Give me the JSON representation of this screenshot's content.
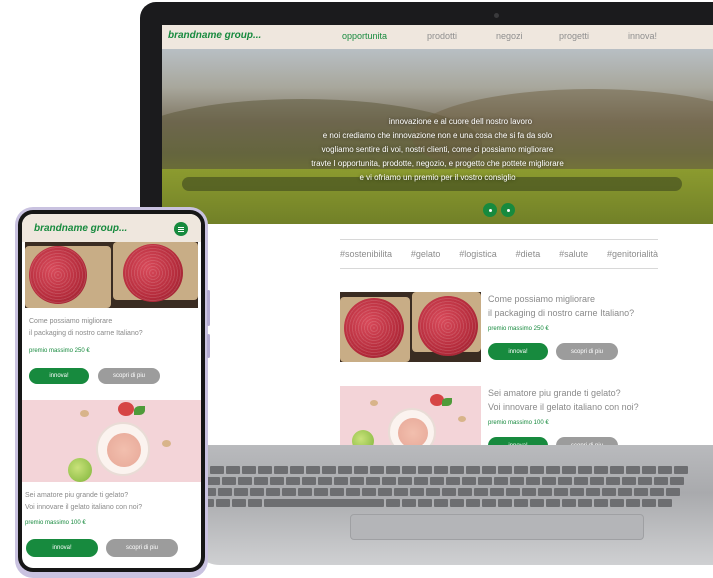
{
  "brand": "brandname group...",
  "desktop": {
    "nav": [
      "opportunita",
      "prodotti",
      "negozi",
      "progetti",
      "innova!"
    ],
    "hero_lines": [
      "innovazione e al cuore dell nostro lavoro",
      "e noi crediamo che innovazione non e una cosa che si fa da solo",
      "vogliamo sentire di voi, nostri clienti, come ci possiamo migliorare",
      "travte I opportunita, prodotte, negozio, e progetto che pottete migliorare",
      "e vi ofriamo un premio per il vostro consiglio"
    ],
    "tags": [
      "#sostenibilita",
      "#gelato",
      "#logistica",
      "#dieta",
      "#salute",
      "#genitorialità"
    ],
    "cards": [
      {
        "title_lines": [
          "Come possiamo migliorare",
          "il packaging di nostro carne Italiano?"
        ],
        "prize": "premio massimo   250 €",
        "primary": "innova!",
        "secondary": "scopri di piu"
      },
      {
        "title_lines": [
          "Sei amatore piu grande ti gelato?",
          "Voi innovare il gelato italiano con noi?"
        ],
        "prize": "premio massimo   100 €",
        "primary": "innova!",
        "secondary": "scopri di piu"
      }
    ]
  },
  "mobile": {
    "cards": [
      {
        "title_lines": [
          "Come possiamo migliorare",
          "il packaging di nostro carne Italiano?"
        ],
        "prize": "premio massimo   250 €",
        "primary": "innova!",
        "secondary": "scopri di piu"
      },
      {
        "title_lines": [
          "Sei amatore piu grande ti gelato?",
          "Voi innovare il gelato italiano con noi?"
        ],
        "prize": "premio massimo   100 €",
        "primary": "innova!",
        "secondary": "scopri di piu"
      }
    ]
  },
  "colors": {
    "brand_green": "#178a3e",
    "nav_bg": "#efe7de",
    "button_grey": "#9c9c9c",
    "text_grey": "#8a8a8a"
  },
  "icons": {
    "menu": "menu-icon",
    "slider_dot": "slider-dot-icon"
  }
}
